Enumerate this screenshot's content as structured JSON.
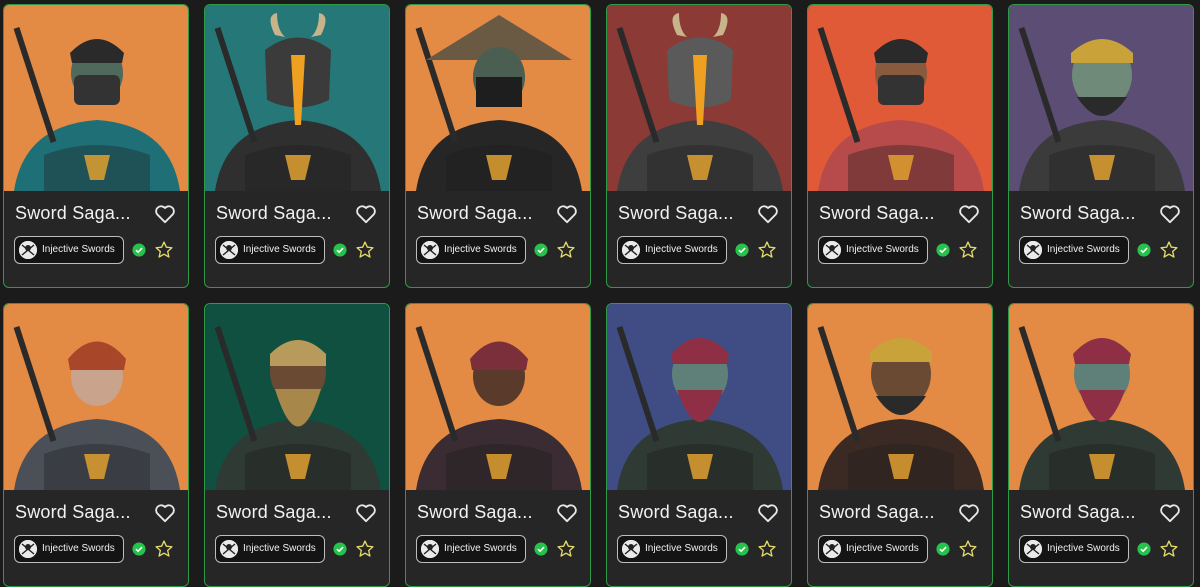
{
  "colors": {
    "card_border": "#2f9a45",
    "verified": "#27c24c",
    "star": "#e4d96a"
  },
  "icons": {
    "heart": "heart-icon",
    "verified": "verified-check-icon",
    "star": "star-icon",
    "collection_logo": "crossed-swords-skull-icon"
  },
  "cards": [
    {
      "title": "Sword Saga...",
      "collection": "Injective Swords",
      "bg": "#e38a44",
      "skin": "#4f6a5c",
      "helm": "mask",
      "outfit": "#1f6f76"
    },
    {
      "title": "Sword Saga...",
      "collection": "Injective Swords",
      "bg": "#267878",
      "skin": "#3b3b3b",
      "helm": "plague",
      "outfit": "#2f2f2f"
    },
    {
      "title": "Sword Saga...",
      "collection": "Injective Swords",
      "bg": "#e38a44",
      "skin": "#4a5e52",
      "helm": "hat",
      "outfit": "#262626"
    },
    {
      "title": "Sword Saga...",
      "collection": "Injective Swords",
      "bg": "#8b3a35",
      "skin": "#5a5a5a",
      "helm": "plague",
      "outfit": "#3e3e3e"
    },
    {
      "title": "Sword Saga...",
      "collection": "Injective Swords",
      "bg": "#e05a38",
      "skin": "#8a5a3e",
      "helm": "mask",
      "outfit": "#b74a4a"
    },
    {
      "title": "Sword Saga...",
      "collection": "Injective Swords",
      "bg": "#5b4d74",
      "skin": "#6f8a78",
      "helm": "bandana",
      "outfit": "#3b3b3b"
    },
    {
      "title": "Sword Saga...",
      "collection": "Injective Swords",
      "bg": "#e38a44",
      "skin": "#c9a38c",
      "helm": "hair",
      "outfit": "#4a4f58"
    },
    {
      "title": "Sword Saga...",
      "collection": "Injective Swords",
      "bg": "#0f5040",
      "skin": "#6b4a34",
      "helm": "viking",
      "outfit": "#2f3a34"
    },
    {
      "title": "Sword Saga...",
      "collection": "Injective Swords",
      "bg": "#e38a44",
      "skin": "#5a3a2a",
      "helm": "braids",
      "outfit": "#3a2c32"
    },
    {
      "title": "Sword Saga...",
      "collection": "Injective Swords",
      "bg": "#3f4d84",
      "skin": "#5f8078",
      "helm": "redhair",
      "outfit": "#2f3a34"
    },
    {
      "title": "Sword Saga...",
      "collection": "Injective Swords",
      "bg": "#e38a44",
      "skin": "#6b4a34",
      "helm": "bandana",
      "outfit": "#3b2a24"
    },
    {
      "title": "Sword Saga...",
      "collection": "Injective Swords",
      "bg": "#e38a44",
      "skin": "#5f8078",
      "helm": "redhair",
      "outfit": "#2f3a34"
    }
  ]
}
